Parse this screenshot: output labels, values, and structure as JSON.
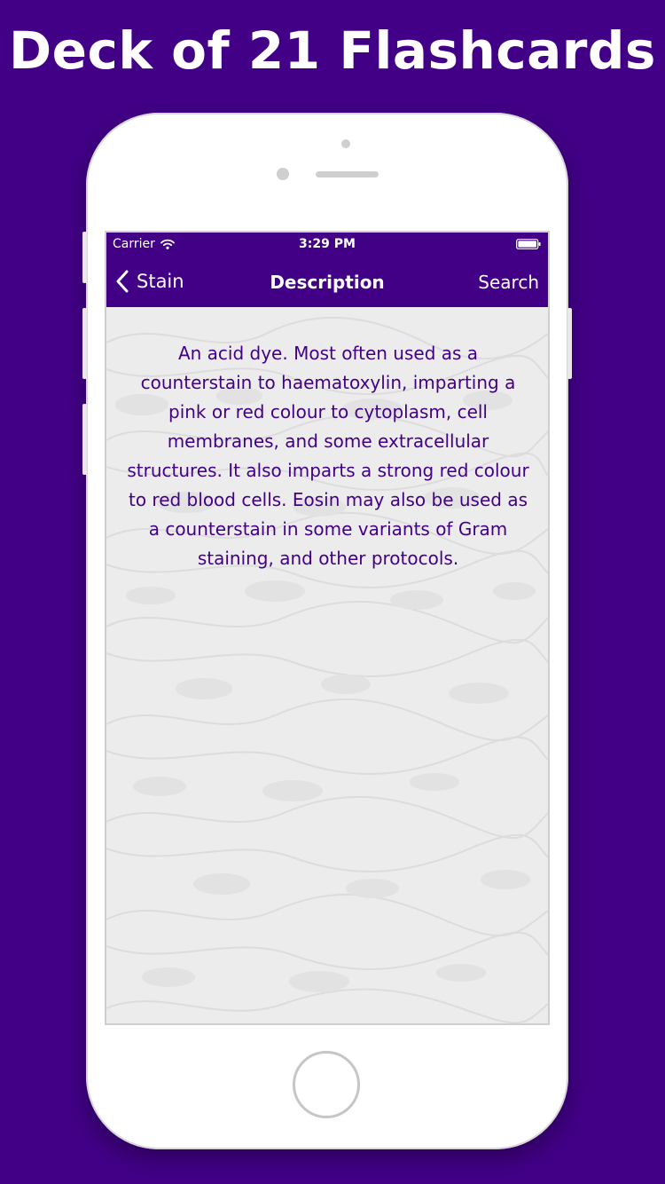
{
  "promo": {
    "headline": "Deck of 21 Flashcards"
  },
  "status_bar": {
    "carrier": "Carrier",
    "time": "3:29 PM",
    "wifi_icon": "wifi-icon",
    "battery_icon": "battery-icon"
  },
  "nav": {
    "back_label": "Stain",
    "back_icon": "chevron-left-icon",
    "title": "Description",
    "search_label": "Search"
  },
  "card": {
    "description": "An acid dye. Most often used as a counterstain to haematoxylin, imparting a pink or red colour to cytoplasm, cell membranes, and some extracellular structures. It also imparts a strong red colour to red blood cells. Eosin may also be used as a counterstain in some variants of Gram staining, and other protocols."
  },
  "colors": {
    "brand_purple": "#420087",
    "text_purple": "#420087",
    "screen_bg": "#ececec",
    "device_white": "#ffffff"
  }
}
